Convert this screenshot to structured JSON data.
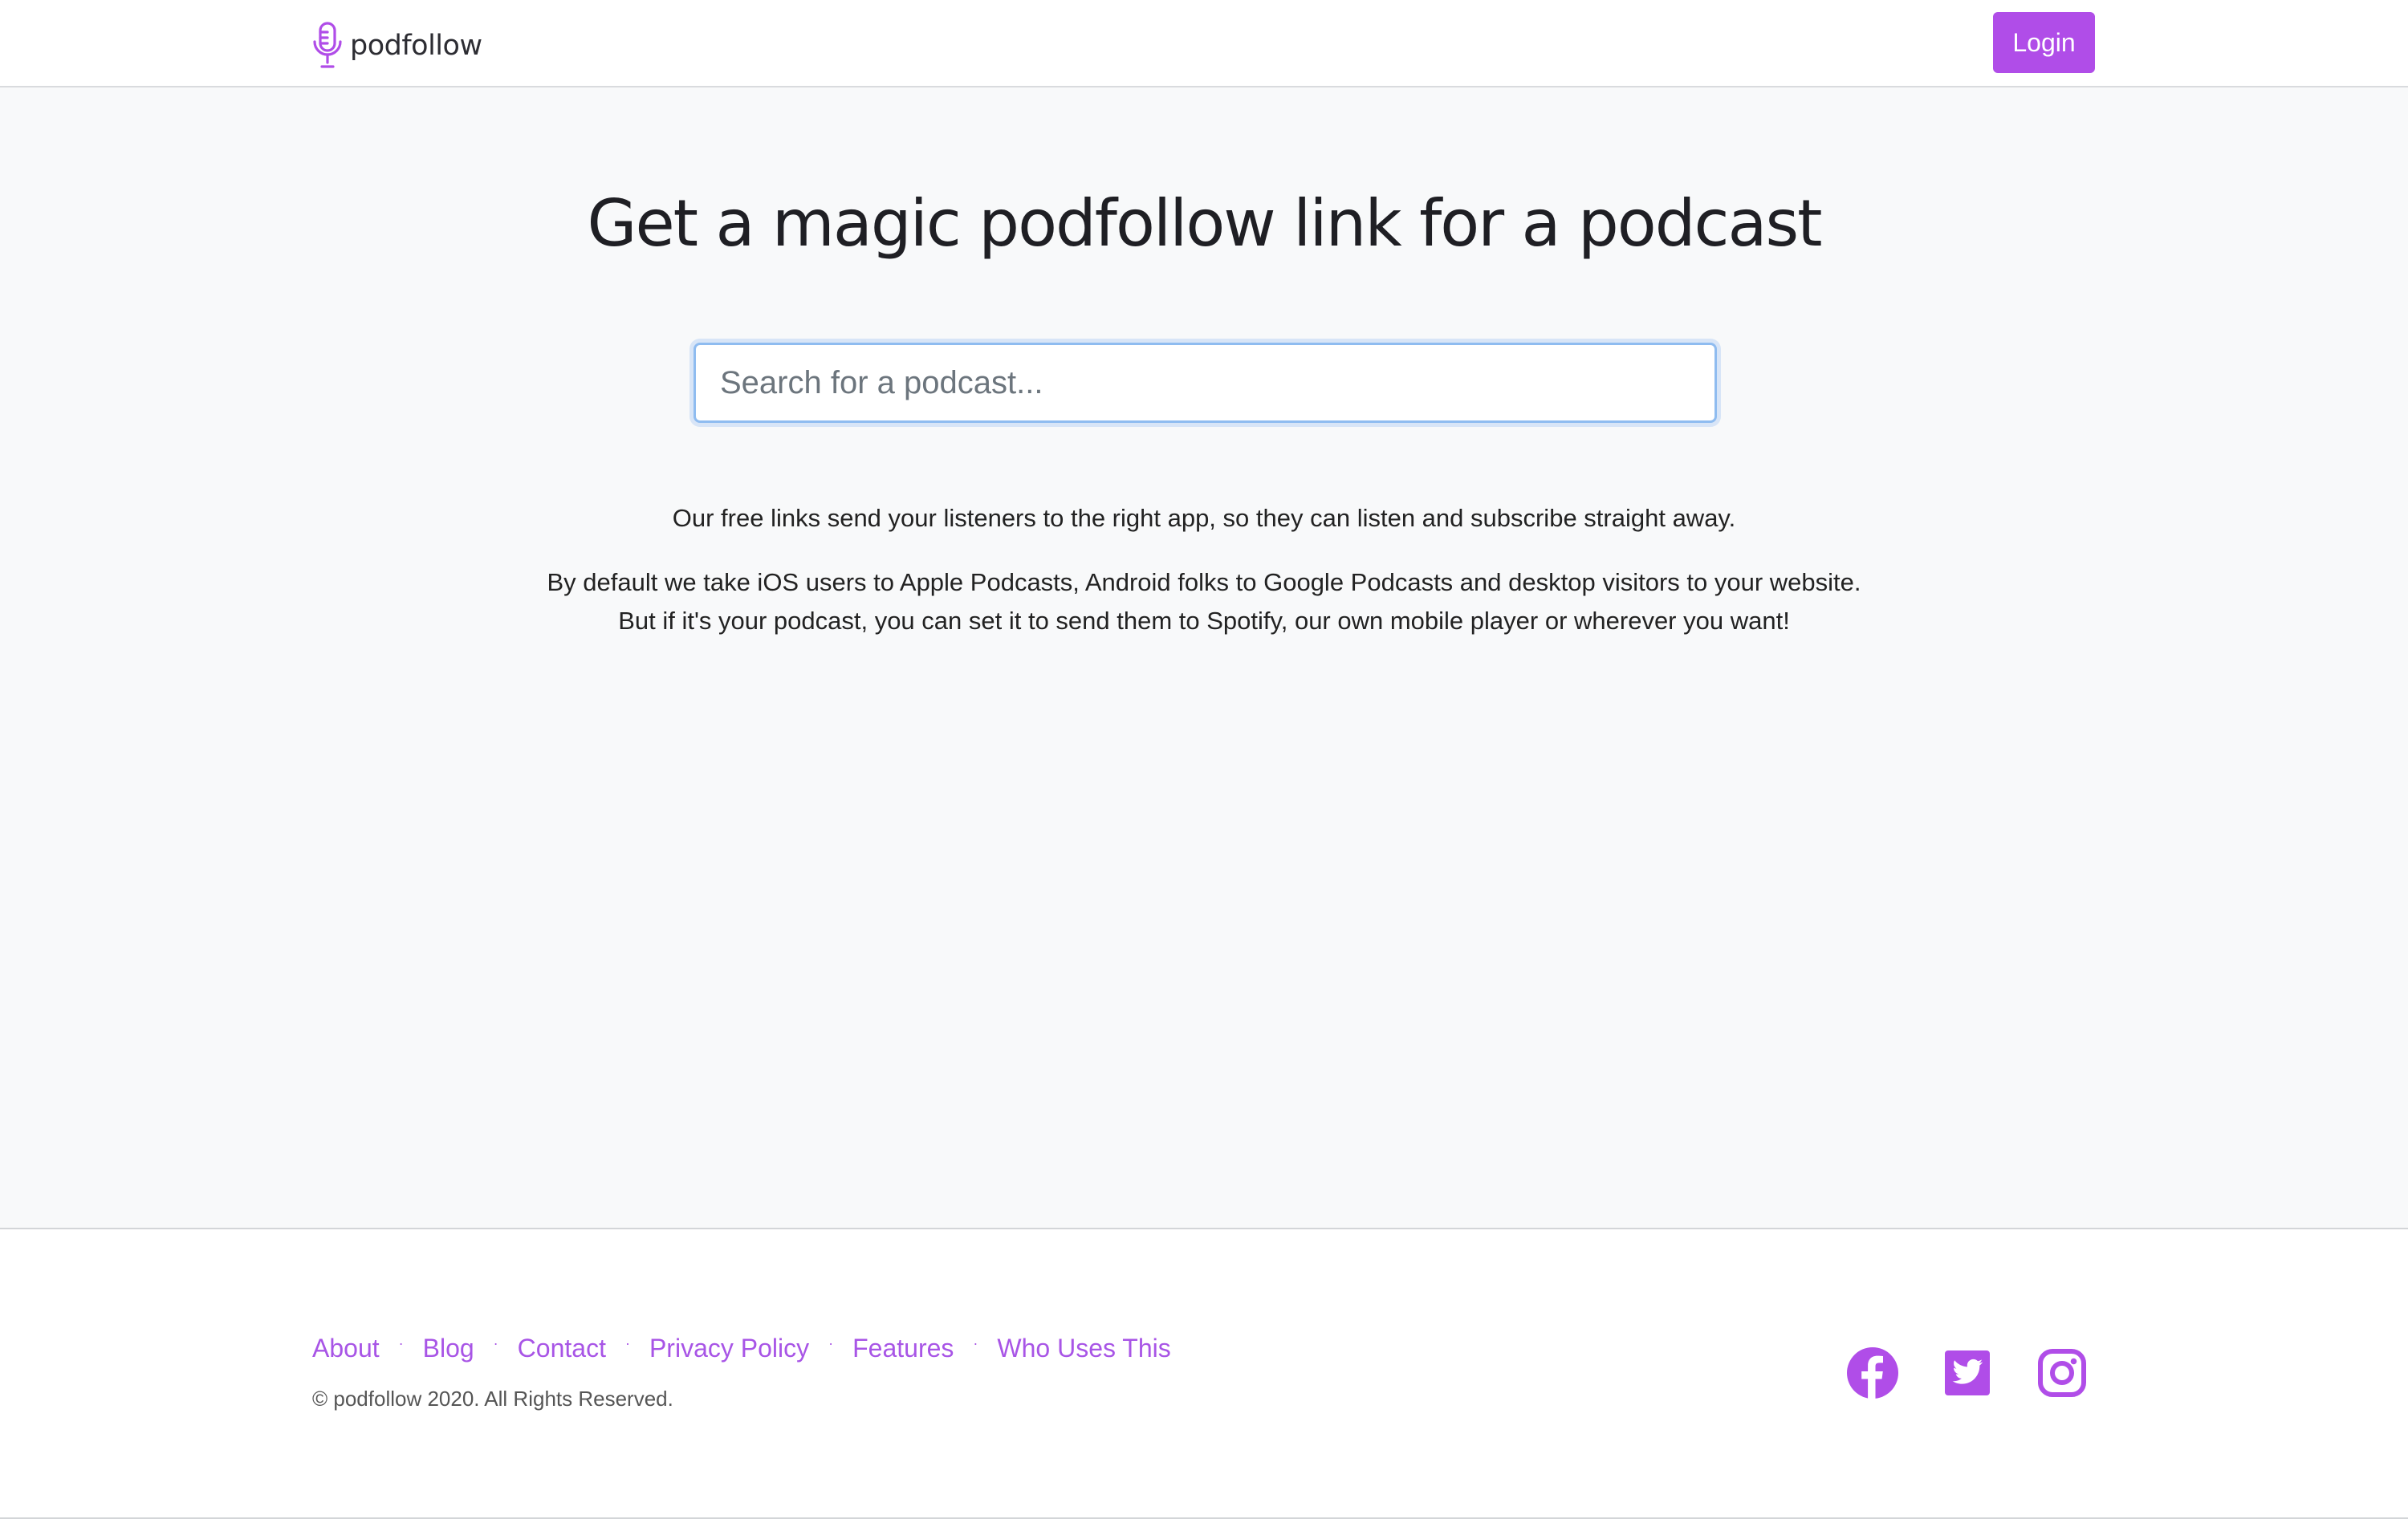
{
  "header": {
    "brand_name": "podfollow",
    "login_label": "Login",
    "logo_icon": "microphone-icon"
  },
  "main": {
    "headline": "Get a magic podfollow link for a podcast",
    "search_placeholder": "Search for a podcast...",
    "search_value": "",
    "description_1": "Our free links send your listeners to the right app, so they can listen and subscribe straight away.",
    "description_2_line_1": "By default we take iOS users to Apple Podcasts, Android folks to Google Podcasts and desktop visitors to your website.",
    "description_2_line_2": "But if it's your podcast, you can set it to send them to Spotify, our own mobile player or wherever you want!"
  },
  "footer": {
    "links": [
      "About",
      "Blog",
      "Contact",
      "Privacy Policy",
      "Features",
      "Who Uses This"
    ],
    "separator": "·",
    "copyright": "© podfollow 2020. All Rights Reserved.",
    "social_icons": [
      "facebook-icon",
      "twitter-icon",
      "instagram-icon"
    ]
  },
  "colors": {
    "accent": "#b04de8",
    "link": "#a855e6",
    "page_background": "#f8f9fa",
    "header_background": "#ffffff",
    "search_focus_border": "#8fbcf0"
  }
}
